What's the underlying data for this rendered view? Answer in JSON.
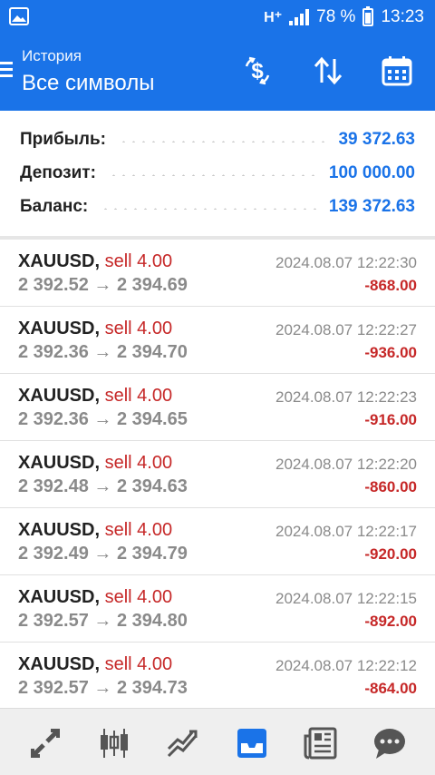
{
  "status_bar": {
    "network": "H⁺",
    "battery_percent": "78 %",
    "battery_level": 0.78,
    "time": "13:23",
    "icons": [
      "image-icon",
      "signal-icon",
      "battery-icon"
    ]
  },
  "header": {
    "subtitle": "История",
    "title": "Все символы",
    "actions": [
      "currency-exchange-icon",
      "sort-icon",
      "calendar-icon"
    ],
    "menu_icon": "menu-icon"
  },
  "summary": {
    "profit_label": "Прибыль:",
    "profit_value": "39 372.63",
    "deposit_label": "Депозит:",
    "deposit_value": "100 000.00",
    "balance_label": "Баланс:",
    "balance_value": "139 372.63"
  },
  "trades": [
    {
      "symbol": "XAUUSD,",
      "side": "sell 4.00",
      "open": "2 392.52",
      "arrow": "→",
      "close": "2 394.69",
      "time": "2024.08.07 12:22:30",
      "pl": "-868.00"
    },
    {
      "symbol": "XAUUSD,",
      "side": "sell 4.00",
      "open": "2 392.36",
      "arrow": "→",
      "close": "2 394.70",
      "time": "2024.08.07 12:22:27",
      "pl": "-936.00"
    },
    {
      "symbol": "XAUUSD,",
      "side": "sell 4.00",
      "open": "2 392.36",
      "arrow": "→",
      "close": "2 394.65",
      "time": "2024.08.07 12:22:23",
      "pl": "-916.00"
    },
    {
      "symbol": "XAUUSD,",
      "side": "sell 4.00",
      "open": "2 392.48",
      "arrow": "→",
      "close": "2 394.63",
      "time": "2024.08.07 12:22:20",
      "pl": "-860.00"
    },
    {
      "symbol": "XAUUSD,",
      "side": "sell 4.00",
      "open": "2 392.49",
      "arrow": "→",
      "close": "2 394.79",
      "time": "2024.08.07 12:22:17",
      "pl": "-920.00"
    },
    {
      "symbol": "XAUUSD,",
      "side": "sell 4.00",
      "open": "2 392.57",
      "arrow": "→",
      "close": "2 394.80",
      "time": "2024.08.07 12:22:15",
      "pl": "-892.00"
    },
    {
      "symbol": "XAUUSD,",
      "side": "sell 4.00",
      "open": "2 392.57",
      "arrow": "→",
      "close": "2 394.73",
      "time": "2024.08.07 12:22:12",
      "pl": "-864.00"
    }
  ],
  "bottom_nav": {
    "items": [
      "quotes-icon",
      "chart-icon",
      "trade-icon",
      "history-icon",
      "news-icon",
      "chat-icon"
    ],
    "active": "history-icon"
  },
  "colors": {
    "accent": "#1a73e8",
    "loss": "#c62828",
    "muted": "#8a8a8a",
    "nav_inactive": "#555555"
  }
}
